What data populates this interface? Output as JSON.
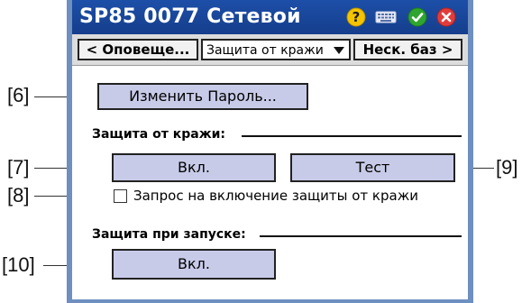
{
  "window": {
    "title": "SP85 0077 Сетевой",
    "icons": [
      "help-icon",
      "keyboard-icon",
      "ok-icon",
      "close-icon"
    ],
    "colors": {
      "titlebar": "#1d4fa8",
      "help": "#f5c400",
      "ok": "#2fa52f",
      "close": "#e23b3b"
    }
  },
  "navbar": {
    "prev_label": "< Оповеще...",
    "combo_value": "Защита от кражи",
    "next_label": "Неск. баз >"
  },
  "main": {
    "change_password_label": "Изменить Пароль...",
    "theft": {
      "title": "Защита от кражи:",
      "on_label": "Вкл.",
      "test_label": "Тест",
      "prompt_label": "Запрос на включение защиты от кражи",
      "prompt_checked": false
    },
    "startup": {
      "title": "Защита при запуске:",
      "on_label": "Вкл."
    }
  },
  "callouts": {
    "c6": "[6]",
    "c7": "[7]",
    "c8": "[8]",
    "c9": "[9]",
    "c10": "[10]"
  }
}
